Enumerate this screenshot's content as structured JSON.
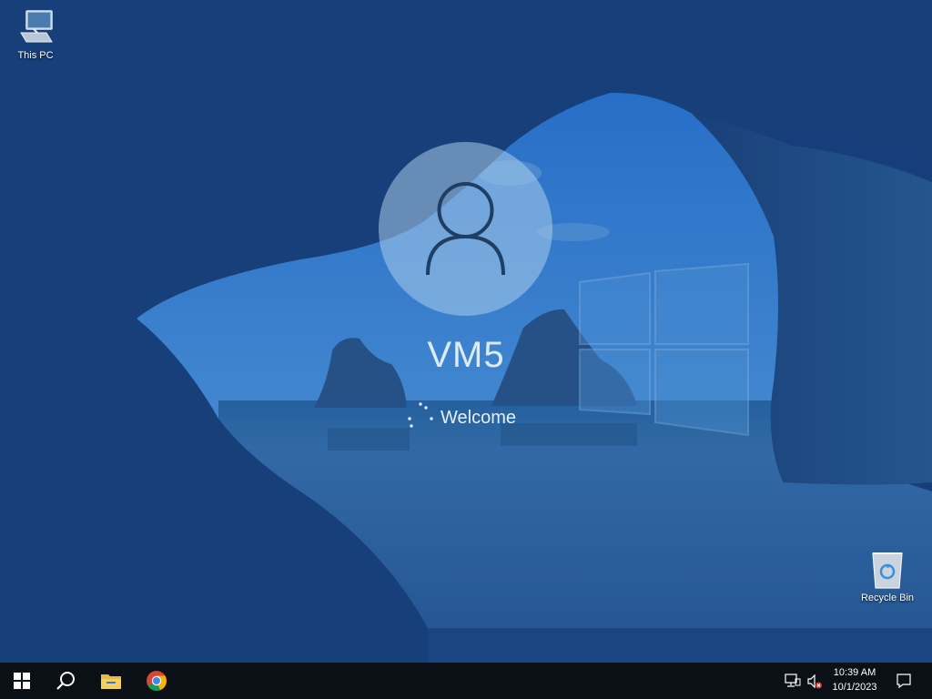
{
  "desktop": {
    "icons": [
      {
        "label": "This PC",
        "icon": "computer-icon"
      },
      {
        "label": "Recycle Bin",
        "icon": "recycle-bin-icon"
      }
    ]
  },
  "login": {
    "avatar_icon": "user-icon",
    "user_name": "VM5",
    "status_text": "Welcome",
    "spinner_icon": "loading-spinner-icon"
  },
  "taskbar": {
    "pinned": [
      {
        "name": "start",
        "icon": "windows-start-icon"
      },
      {
        "name": "search",
        "icon": "search-icon"
      },
      {
        "name": "file-explorer",
        "icon": "folder-icon"
      },
      {
        "name": "chrome",
        "icon": "chrome-icon"
      }
    ],
    "tray": {
      "network_icon": "network-icon",
      "volume_icon": "volume-muted-icon",
      "time": "10:39 AM",
      "date": "10/1/2023",
      "notification_icon": "notification-icon"
    }
  },
  "colors": {
    "taskbar": "#0b0f16",
    "avatar_fill": "#aacdeb",
    "text": "#dcecff"
  }
}
